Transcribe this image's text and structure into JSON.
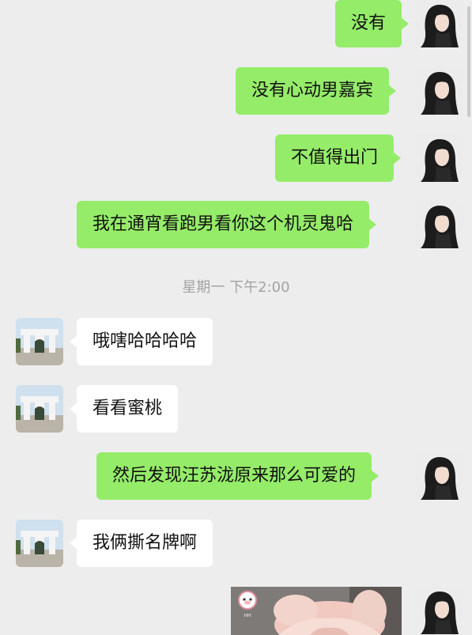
{
  "messages": [
    {
      "side": "sent",
      "text": "没有"
    },
    {
      "side": "sent",
      "text": "没有心动男嘉宾"
    },
    {
      "side": "sent",
      "text": "不值得出门"
    },
    {
      "side": "sent",
      "text": "我在通宵看跑男看你这个机灵鬼哈"
    },
    {
      "side": "recv",
      "text": "哦嗐哈哈哈哈"
    },
    {
      "side": "recv",
      "text": "看看蜜桃"
    },
    {
      "side": "sent",
      "text": "然后发现汪苏泷原来那么可爱的"
    },
    {
      "side": "recv",
      "text": "我俩撕名牌啊"
    },
    {
      "side": "sent",
      "type": "image"
    }
  ],
  "timestamp": "星期一 下午2:00",
  "image_message": {
    "sticker_text": "ᴴᴴ"
  },
  "colors": {
    "background": "#ededed",
    "sent_bubble": "#95ec69",
    "recv_bubble": "#ffffff",
    "timestamp": "#a3a3a3"
  }
}
